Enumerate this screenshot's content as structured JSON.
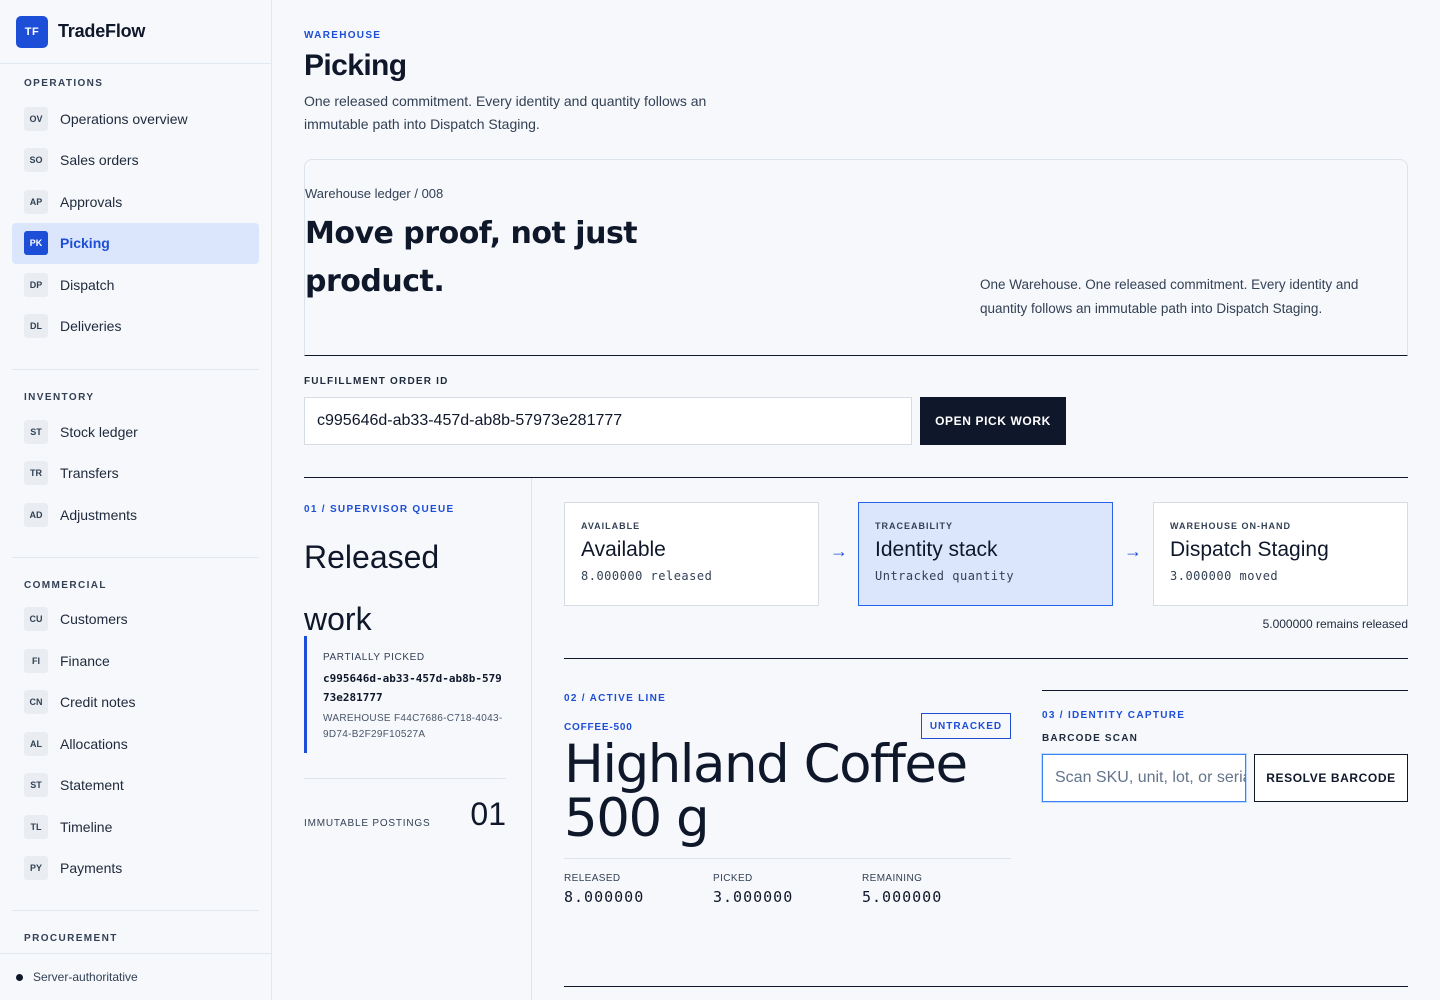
{
  "brand": {
    "logo": "TF",
    "name": "TradeFlow"
  },
  "sidebar": {
    "sections": [
      {
        "title": "OPERATIONS",
        "items": [
          {
            "code": "OV",
            "label": "Operations overview"
          },
          {
            "code": "SO",
            "label": "Sales orders"
          },
          {
            "code": "AP",
            "label": "Approvals"
          },
          {
            "code": "PK",
            "label": "Picking",
            "active": true
          },
          {
            "code": "DP",
            "label": "Dispatch"
          },
          {
            "code": "DL",
            "label": "Deliveries"
          }
        ]
      },
      {
        "title": "INVENTORY",
        "items": [
          {
            "code": "ST",
            "label": "Stock ledger"
          },
          {
            "code": "TR",
            "label": "Transfers"
          },
          {
            "code": "AD",
            "label": "Adjustments"
          }
        ]
      },
      {
        "title": "COMMERCIAL",
        "items": [
          {
            "code": "CU",
            "label": "Customers"
          },
          {
            "code": "FI",
            "label": "Finance"
          },
          {
            "code": "CN",
            "label": "Credit notes"
          },
          {
            "code": "AL",
            "label": "Allocations"
          },
          {
            "code": "ST",
            "label": "Statement"
          },
          {
            "code": "TL",
            "label": "Timeline"
          },
          {
            "code": "PY",
            "label": "Payments"
          }
        ]
      },
      {
        "title": "PROCUREMENT",
        "items": []
      }
    ],
    "footer": "Server-authoritative"
  },
  "page": {
    "kicker": "WAREHOUSE",
    "title": "Picking",
    "description": "One released commitment. Every identity and quantity follows an immutable path into Dispatch Staging."
  },
  "hero": {
    "label": "Warehouse ledger / 008",
    "title": "Move proof, not just product.",
    "description": "One Warehouse. One released commitment. Every identity and quantity follows an immutable path into Dispatch Staging."
  },
  "order": {
    "label": "FULFILLMENT ORDER ID",
    "value": "c995646d-ab33-457d-ab8b-57973e281777",
    "button": "OPEN PICK WORK"
  },
  "queue": {
    "kicker": "01 / SUPERVISOR QUEUE",
    "title": "Released work",
    "status": "PARTIALLY PICKED",
    "order_id": "c995646d-ab33-457d-ab8b-57973e281777",
    "warehouse": "WAREHOUSE F44C7686-C718-4043-9D74-B2F29F10527A",
    "postings_label": "IMMUTABLE POSTINGS",
    "postings_count": "01"
  },
  "flow": {
    "steps": [
      {
        "kicker": "AVAILABLE",
        "title": "Available",
        "sub": "8.000000 released"
      },
      {
        "kicker": "TRACEABILITY",
        "title": "Identity stack",
        "sub": "Untracked quantity"
      },
      {
        "kicker": "WAREHOUSE ON-HAND",
        "title": "Dispatch Staging",
        "sub": "3.000000 moved"
      }
    ],
    "arrow": "→",
    "note": "5.000000 remains released"
  },
  "active_line": {
    "kicker": "02 / ACTIVE LINE",
    "sku": "COFFEE-500",
    "badge": "UNTRACKED",
    "title": "Highland Coffee 500 g",
    "metrics": [
      {
        "label": "RELEASED",
        "value": "8.000000"
      },
      {
        "label": "PICKED",
        "value": "3.000000"
      },
      {
        "label": "REMAINING",
        "value": "5.000000"
      }
    ]
  },
  "identity": {
    "kicker": "03 / IDENTITY CAPTURE",
    "label": "BARCODE SCAN",
    "placeholder": "Scan SKU, unit, lot, or serial",
    "button": "RESOLVE BARCODE"
  },
  "colors": {
    "accent": "#1d4ed8",
    "ink": "#0f172a",
    "highlight": "#dbe6fd"
  }
}
